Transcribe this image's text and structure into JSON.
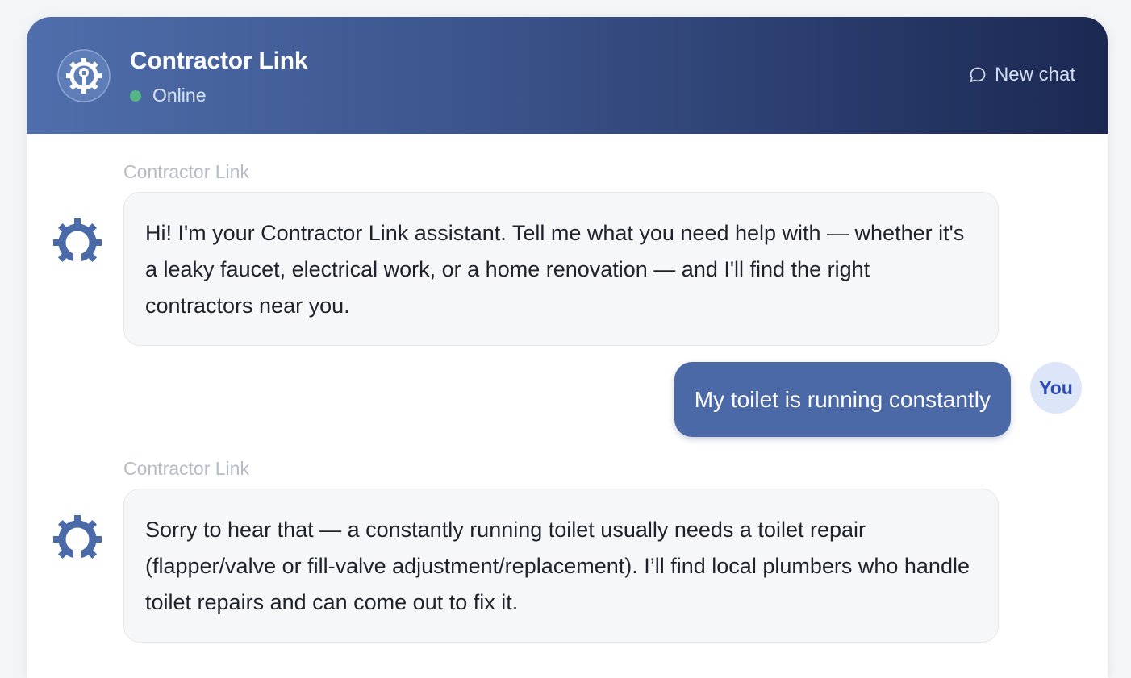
{
  "header": {
    "title": "Contractor Link",
    "status": "Online",
    "new_chat_label": "New chat"
  },
  "messages": [
    {
      "role": "bot",
      "sender": "Contractor Link",
      "text": "Hi! I'm your Contractor Link assistant. Tell me what you need help with — whether it's a leaky faucet, electrical work, or a home renovation — and I'll find the right contractors near you."
    },
    {
      "role": "user",
      "avatar_label": "You",
      "text": "My toilet is running constantly"
    },
    {
      "role": "bot",
      "sender": "Contractor Link",
      "text": "Sorry to hear that — a constantly running toilet usually needs a toilet repair (flapper/valve or fill-valve adjustment/replacement). I’ll find local plumbers who handle toilet repairs and can come out to fix it."
    }
  ],
  "colors": {
    "header_gradient_start": "#4f6eab",
    "header_gradient_end": "#1b2852",
    "online_dot": "#55b685",
    "user_bubble": "#4b68a7",
    "bot_icon": "#4a6aa8"
  },
  "icons": {
    "logo": "gear-wrench-icon",
    "new_chat": "chat-bubble-icon",
    "bot_avatar": "gear-icon"
  }
}
